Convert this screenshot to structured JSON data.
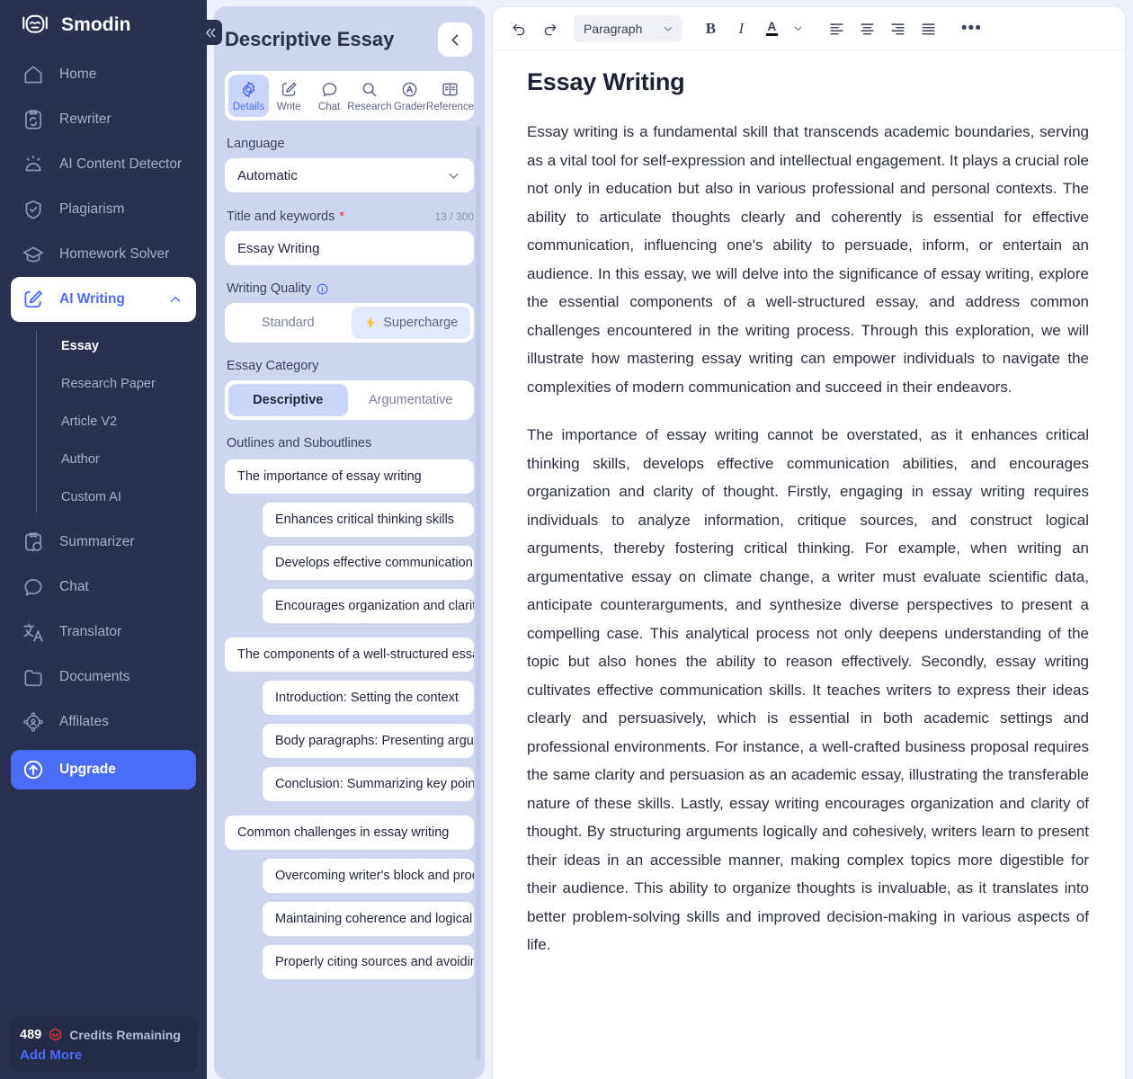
{
  "sidebar": {
    "brand": "Smodin",
    "collapse_icon": "chevrons-left-icon",
    "items": [
      {
        "label": "Home",
        "icon": "home-icon"
      },
      {
        "label": "Rewriter",
        "icon": "rewrite-clipboard-icon"
      },
      {
        "label": "AI Content Detector",
        "icon": "alarm-icon"
      },
      {
        "label": "Plagiarism",
        "icon": "shield-check-icon"
      },
      {
        "label": "Homework Solver",
        "icon": "graduation-cap-icon"
      },
      {
        "label": "AI Writing",
        "icon": "pencil-square-icon",
        "active": true,
        "expanded": true
      },
      {
        "label": "Summarizer",
        "icon": "summarize-clipboard-icon"
      },
      {
        "label": "Chat",
        "icon": "chat-bubble-icon"
      },
      {
        "label": "Translator",
        "icon": "translate-icon"
      },
      {
        "label": "Documents",
        "icon": "folder-icon"
      },
      {
        "label": "Affilates",
        "icon": "affiliate-network-icon"
      }
    ],
    "subitems": [
      {
        "label": "Essay",
        "active": true
      },
      {
        "label": "Research Paper",
        "active": false
      },
      {
        "label": "Article V2",
        "active": false
      },
      {
        "label": "Author",
        "active": false
      },
      {
        "label": "Custom AI",
        "active": false
      }
    ],
    "upgrade": {
      "label": "Upgrade",
      "icon": "upgrade-arrow-icon"
    },
    "credits": {
      "count": "489",
      "icon": "credit-token-icon",
      "label": "Credits Remaining",
      "add_more": "Add More"
    },
    "accent": "#4a6cf7",
    "background": "#2a3050"
  },
  "panel": {
    "title": "Descriptive Essay",
    "back_icon": "chevron-left-icon",
    "tabs": [
      {
        "label": "Details",
        "icon": "gear-icon",
        "active": true
      },
      {
        "label": "Write",
        "icon": "pencil-square-icon",
        "active": false
      },
      {
        "label": "Chat",
        "icon": "chat-bubble-icon",
        "active": false
      },
      {
        "label": "Research",
        "icon": "search-icon",
        "active": false
      },
      {
        "label": "Grader",
        "icon": "grader-circle-icon",
        "active": false
      },
      {
        "label": "Reference",
        "icon": "open-book-icon",
        "active": false
      }
    ],
    "language": {
      "label": "Language",
      "value": "Automatic",
      "chevron": "chevron-down-icon"
    },
    "title_field": {
      "label": "Title and keywords",
      "required_marker": "*",
      "counter": "13 / 300",
      "value": "Essay Writing"
    },
    "writing_quality": {
      "label": "Writing Quality",
      "info_icon": "info-icon",
      "options": [
        {
          "label": "Standard",
          "selected": false
        },
        {
          "label": "Supercharge",
          "selected": true,
          "icon": "lightning-bolt-icon"
        }
      ]
    },
    "essay_category": {
      "label": "Essay Category",
      "options": [
        {
          "label": "Descriptive",
          "selected": true
        },
        {
          "label": "Argumentative",
          "selected": false
        }
      ]
    },
    "outlines": {
      "label": "Outlines and Suboutlines",
      "items": [
        {
          "level": 0,
          "text": "The importance of essay writing"
        },
        {
          "level": 1,
          "text": "Enhances critical thinking skills"
        },
        {
          "level": 1,
          "text": "Develops effective communication"
        },
        {
          "level": 1,
          "text": "Encourages organization and clarity"
        },
        {
          "level": 0,
          "text": "The components of a well-structured essay"
        },
        {
          "level": 1,
          "text": "Introduction: Setting the context"
        },
        {
          "level": 1,
          "text": "Body paragraphs: Presenting arguments"
        },
        {
          "level": 1,
          "text": "Conclusion: Summarizing key points"
        },
        {
          "level": 0,
          "text": "Common challenges in essay writing"
        },
        {
          "level": 1,
          "text": "Overcoming writer's block and procrastination"
        },
        {
          "level": 1,
          "text": "Maintaining coherence and logical flow"
        },
        {
          "level": 1,
          "text": "Properly citing sources and avoiding plagiarism"
        }
      ]
    }
  },
  "toolbar": {
    "undo": "undo-icon",
    "redo": "redo-icon",
    "block_style": "Paragraph",
    "block_chevron": "chevron-down-icon",
    "bold": "B",
    "italic": "I",
    "text_color": "A",
    "color_chevron": "chevron-down-icon",
    "align_left": "align-left-icon",
    "align_center": "align-center-icon",
    "align_right": "align-right-icon",
    "align_justify": "align-justify-icon",
    "more": "•••"
  },
  "document": {
    "title": "Essay Writing",
    "paragraphs": [
      "Essay writing is a fundamental skill that transcends academic boundaries, serving as a vital tool for self-expression and intellectual engagement. It plays a crucial role not only in education but also in various professional and personal contexts. The ability to articulate thoughts clearly and coherently is essential for effective communication, influencing one's ability to persuade, inform, or entertain an audience. In this essay, we will delve into the significance of essay writing, explore the essential components of a well-structured essay, and address common challenges encountered in the writing process. Through this exploration, we will illustrate how mastering essay writing can empower individuals to navigate the complexities of modern communication and succeed in their endeavors.",
      "The importance of essay writing cannot be overstated, as it enhances critical thinking skills, develops effective communication abilities, and encourages organization and clarity of thought. Firstly, engaging in essay writing requires individuals to analyze information, critique sources, and construct logical arguments, thereby fostering critical thinking. For example, when writing an argumentative essay on climate change, a writer must evaluate scientific data, anticipate counterarguments, and synthesize diverse perspectives to present a compelling case. This analytical process not only deepens understanding of the topic but also hones the ability to reason effectively. Secondly, essay writing cultivates effective communication skills. It teaches writers to express their ideas clearly and persuasively, which is essential in both academic settings and professional environments. For instance, a well-crafted business proposal requires the same clarity and persuasion as an academic essay, illustrating the transferable nature of these skills. Lastly, essay writing encourages organization and clarity of thought. By structuring arguments logically and cohesively, writers learn to present their ideas in an accessible manner, making complex topics more digestible for their audience. This ability to organize thoughts is invaluable, as it translates into better problem-solving skills and improved decision-making in various aspects of life."
    ]
  }
}
